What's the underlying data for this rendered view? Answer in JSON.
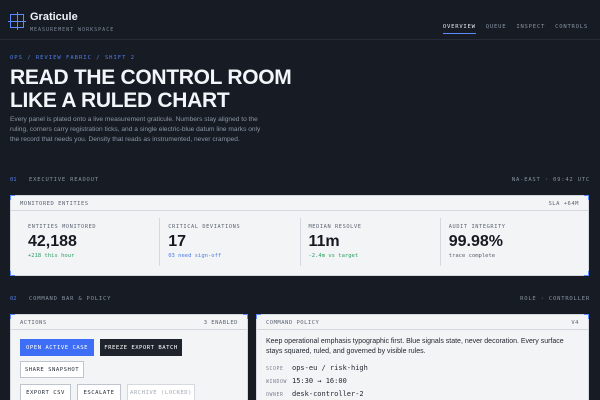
{
  "brand": {
    "name": "Graticule",
    "subtitle": "MEASUREMENT WORKSPACE",
    "icon": "crosshair-icon"
  },
  "nav": {
    "items": [
      "OVERVIEW",
      "QUEUE",
      "INSPECT",
      "CONTROLS"
    ],
    "active": "OVERVIEW"
  },
  "hero": {
    "breadcrumb": "OPS / REVIEW FABRIC / SHIFT 2",
    "headline_line1": "READ THE CONTROL ROOM",
    "headline_line2": "LIKE A RULED CHART",
    "intro": "Every panel is plated onto a live measurement graticule. Numbers stay aligned to the ruling, corners carry registration ticks, and a single electric-blue datum line marks only the record that needs you. Density that reads as instrumented, never cramped."
  },
  "section1": {
    "number": "01",
    "title": "EXECUTIVE READOUT",
    "meta": "NA-EAST · 09:42 UTC"
  },
  "monitored": {
    "title": "MONITORED ENTITIES",
    "meta": "SLA +64M",
    "metrics": [
      {
        "label": "ENTITIES MONITORED",
        "value": "42,188",
        "note": "+218 this hour",
        "tone": "green"
      },
      {
        "label": "CRITICAL DEVIATIONS",
        "value": "17",
        "note": "03 need sign-off",
        "tone": "blue"
      },
      {
        "label": "MEDIAN RESOLVE",
        "value": "11m",
        "note": "-2.4m vs target",
        "tone": "green"
      },
      {
        "label": "AUDIT INTEGRITY",
        "value": "99.98%",
        "note": "trace complete",
        "tone": "grey"
      }
    ]
  },
  "section2": {
    "number": "02",
    "title": "COMMAND BAR & POLICY",
    "meta": "ROLE · CONTROLLER"
  },
  "actions": {
    "title": "ACTIONS",
    "meta": "3 ENABLED",
    "open_active_case": "OPEN ACTIVE CASE",
    "freeze_export_batch": "FREEZE EXPORT BATCH",
    "share_snapshot": "SHARE SNAPSHOT",
    "export_csv": "EXPORT CSV",
    "escalate": "ESCALATE",
    "archive_locked": "ARCHIVE (LOCKED)"
  },
  "policy": {
    "title": "COMMAND POLICY",
    "meta": "V4",
    "text": "Keep operational emphasis typographic first. Blue signals state, never decoration. Every surface stays squared, ruled, and governed by visible rules.",
    "scope_key": "SCOPE",
    "scope_value": "ops-eu / risk-high",
    "window_key": "WINDOW",
    "window_value": "15:30 → 16:00",
    "owner_key": "OWNER",
    "owner_value": "desk-controller-2"
  },
  "colors": {
    "accent": "#3d6ef5",
    "background": "#171c24",
    "panel": "#f3f4f6",
    "positive": "#2e9d62"
  }
}
